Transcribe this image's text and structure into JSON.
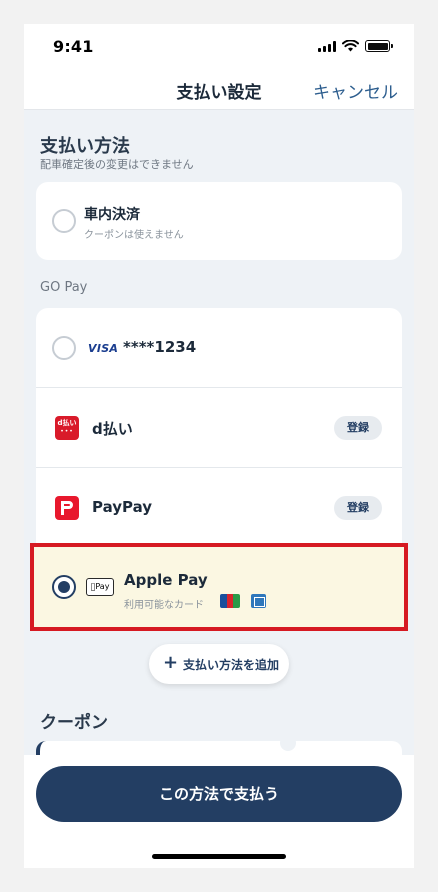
{
  "status_bar": {
    "time": "9:41"
  },
  "nav": {
    "title": "支払い設定",
    "cancel": "キャンセル"
  },
  "payment_method": {
    "title": "支払い方法",
    "subtitle": "配車確定後の変更はできません",
    "in_car": {
      "label": "車内決済",
      "note": "クーポンは使えません",
      "selected": false
    }
  },
  "go_pay": {
    "label": "GO Pay",
    "items": [
      {
        "brand": "VISA",
        "label": "****1234",
        "selected": false
      },
      {
        "logo": "d払い",
        "label": "d払い",
        "action": "登録"
      },
      {
        "label": "PayPay",
        "action": "登録"
      }
    ]
  },
  "apple_pay": {
    "icon_text": "Pay",
    "label": "Apple Pay",
    "note": "利用可能なカード",
    "selected": true,
    "cards": [
      "jcb-icon",
      "amex-icon"
    ]
  },
  "add_button": {
    "label": "支払い方法を追加"
  },
  "coupon": {
    "title": "クーポン"
  },
  "cta": {
    "label": "この方法で支払う"
  },
  "colors": {
    "primary": "#233e63",
    "highlight_border": "#d61a22",
    "highlight_bg": "#fbf7e2",
    "background": "#eef2f6"
  }
}
